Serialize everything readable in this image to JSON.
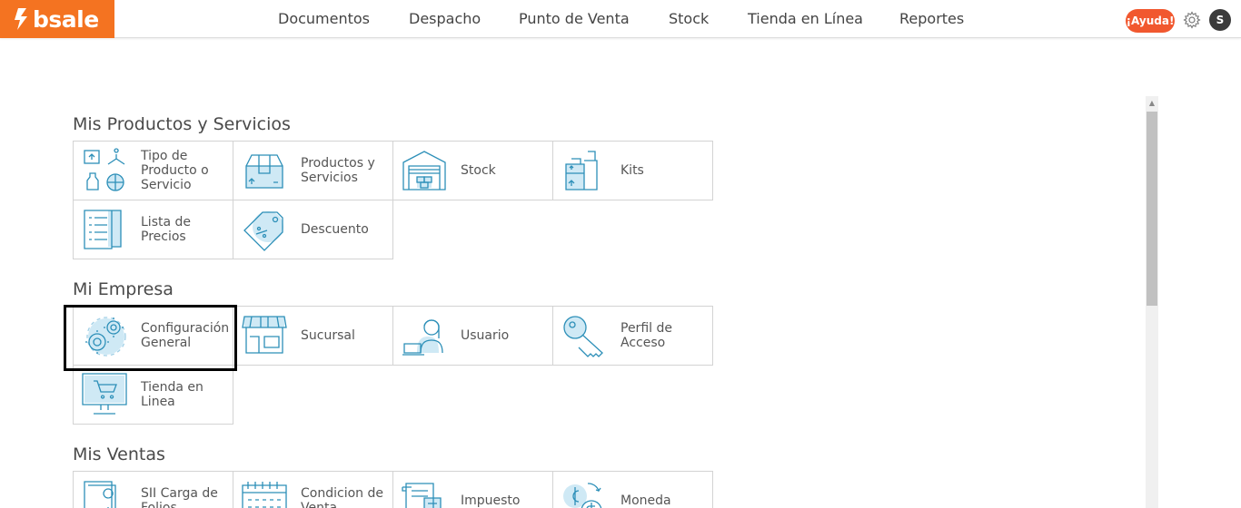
{
  "brand": {
    "name": "bsale",
    "color": "#f47321"
  },
  "nav": [
    "Documentos",
    "Despacho",
    "Punto de Venta",
    "Stock",
    "Tienda en Línea",
    "Reportes"
  ],
  "header": {
    "help_label": "¡Ayuda!",
    "avatar_initial": "S",
    "settings_icon": "gear-icon"
  },
  "sections": [
    {
      "title": "Mis Productos y Servicios",
      "tiles": [
        {
          "label": "Tipo de Producto o Servicio",
          "icon": "product-type-icon"
        },
        {
          "label": "Productos y Servicios",
          "icon": "box-icon"
        },
        {
          "label": "Stock",
          "icon": "warehouse-icon"
        },
        {
          "label": "Kits",
          "icon": "kit-icon"
        },
        {
          "label": "Lista de Precios",
          "icon": "price-list-icon"
        },
        {
          "label": "Descuento",
          "icon": "discount-tag-icon"
        }
      ]
    },
    {
      "title": "Mi Empresa",
      "tiles": [
        {
          "label": "Configuración General",
          "icon": "gears-icon",
          "selected": true
        },
        {
          "label": "Sucursal",
          "icon": "store-icon"
        },
        {
          "label": "Usuario",
          "icon": "user-laptop-icon"
        },
        {
          "label": "Perfil de Acceso",
          "icon": "key-icon"
        },
        {
          "label": "Tienda en Linea",
          "icon": "online-store-icon"
        }
      ]
    },
    {
      "title": "Mis Ventas",
      "tiles": [
        {
          "label": "SII Carga de Folios",
          "icon": "stamp-documents-icon"
        },
        {
          "label": "Condicion de Venta",
          "icon": "calendar-icon"
        },
        {
          "label": "Impuesto",
          "icon": "tax-receipt-icon"
        },
        {
          "label": "Moneda",
          "icon": "currency-icon"
        }
      ]
    }
  ]
}
